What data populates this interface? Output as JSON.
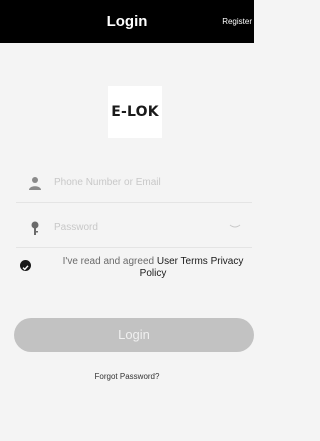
{
  "header": {
    "title": "Login",
    "register_label": "Register"
  },
  "brand": {
    "logo_text": "E-LOK"
  },
  "form": {
    "account_placeholder": "Phone Number or Email",
    "account_icon": "user-icon",
    "password_placeholder": "Password",
    "password_icon": "key-icon",
    "password_toggle_icon": "eye-closed-icon"
  },
  "agreement": {
    "prefix": "I've read and agreed ",
    "terms_label": "User Terms",
    "privacy_label": "Privacy Policy",
    "checked": true
  },
  "login_button_label": "Login",
  "forgot_password_label": "Forgot Password?",
  "colors": {
    "topbar": "#000000",
    "background": "#f4f4f4",
    "button_disabled": "#c2c2c2"
  }
}
